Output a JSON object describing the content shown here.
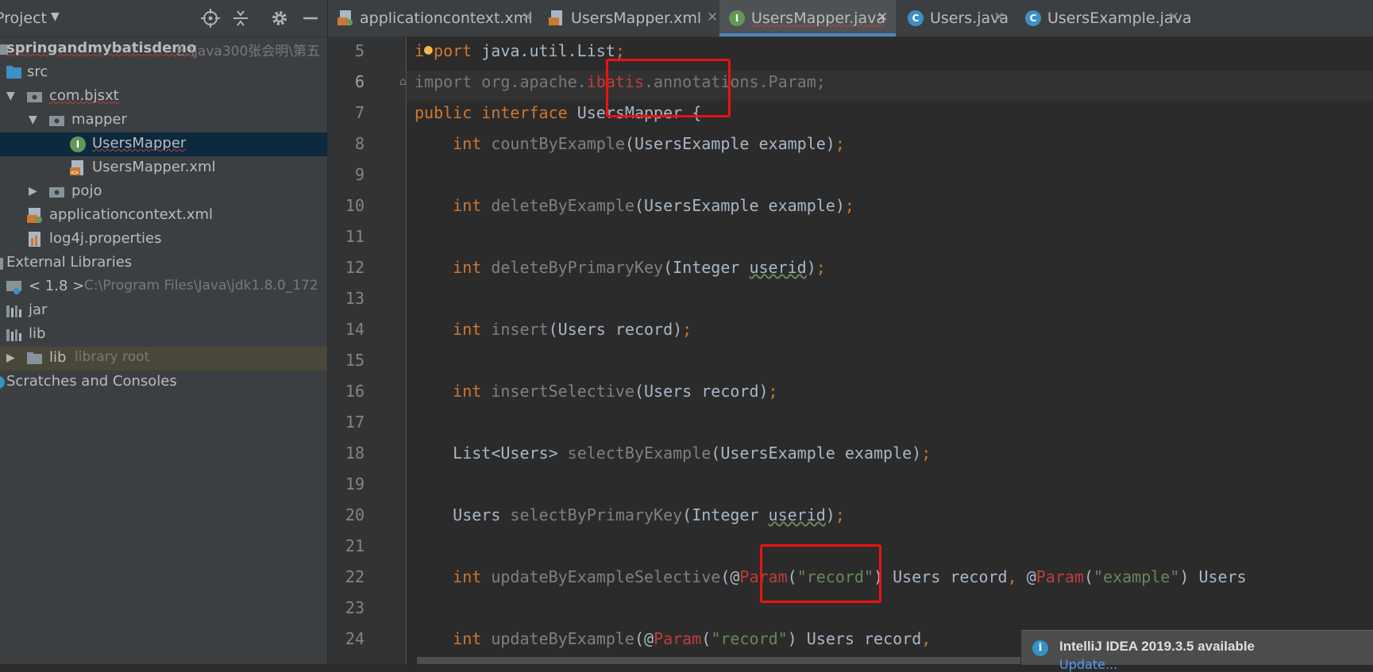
{
  "project_panel": {
    "title": "Project",
    "tree": [
      {
        "label": "springandmybatisdemo",
        "hint": "E:\\java300张会明\\第五"
      },
      {
        "label": "src"
      },
      {
        "label": "com.bjsxt"
      },
      {
        "label": "mapper"
      },
      {
        "label": "UsersMapper"
      },
      {
        "label": "UsersMapper.xml"
      },
      {
        "label": "pojo"
      },
      {
        "label": "applicationcontext.xml"
      },
      {
        "label": "log4j.properties"
      },
      {
        "label": "External Libraries"
      },
      {
        "label": "< 1.8 >",
        "hint": "C:\\Program Files\\Java\\jdk1.8.0_172"
      },
      {
        "label": "jar"
      },
      {
        "label": "lib"
      },
      {
        "label": "lib",
        "hint": "library root"
      },
      {
        "label": "Scratches and Consoles"
      }
    ]
  },
  "tabs": [
    {
      "label": "applicationcontext.xml",
      "icon": "xml-file-icon"
    },
    {
      "label": "UsersMapper.xml",
      "icon": "xml-file-icon"
    },
    {
      "label": "UsersMapper.java",
      "icon": "interface-icon",
      "active": true
    },
    {
      "label": "Users.java",
      "icon": "class-icon"
    },
    {
      "label": "UsersExample.java",
      "icon": "class-icon"
    }
  ],
  "editor": {
    "line_numbers": [
      "5",
      "6",
      "7",
      "8",
      "9",
      "10",
      "11",
      "12",
      "13",
      "14",
      "15",
      "16",
      "17",
      "18",
      "19",
      "20",
      "21",
      "22",
      "23",
      "24"
    ],
    "current_line": "6",
    "code": {
      "l5_a": "i",
      "l5_b": "port ",
      "l5_c": "java.util.List",
      "l5_d": ";",
      "l6_a": "import ",
      "l6_b": "org.apache.",
      "l6_c": "ibatis",
      "l6_d": ".annotations.Param;",
      "l7_a": "public interface ",
      "l7_b": "UsersMapper {",
      "l8_kw": "int ",
      "l8_m": "countByExample",
      "l8_rest": "(UsersExample example)",
      "l8_p": ";",
      "l10_kw": "int ",
      "l10_m": "deleteByExample",
      "l10_rest": "(UsersExample example)",
      "l10_p": ";",
      "l12_kw": "int ",
      "l12_m": "deleteByPrimaryKey",
      "l12_a": "(Integer ",
      "l12_b": "userid",
      "l12_c": ")",
      "l12_p": ";",
      "l14_kw": "int ",
      "l14_m": "insert",
      "l14_rest": "(Users record)",
      "l14_p": ";",
      "l16_kw": "int ",
      "l16_m": "insertSelective",
      "l16_rest": "(Users record)",
      "l16_p": ";",
      "l18_a": "List<Users> ",
      "l18_m": "selectByExample",
      "l18_rest": "(UsersExample example)",
      "l18_p": ";",
      "l20_a": "Users ",
      "l20_m": "selectByPrimaryKey",
      "l20_b": "(Integer ",
      "l20_c": "userid",
      "l20_d": ")",
      "l20_p": ";",
      "l22_kw": "int ",
      "l22_m": "updateByExampleSelective",
      "l22_a": "(@",
      "l22_b": "Param",
      "l22_c": "(",
      "l22_d": "\"record\"",
      "l22_e": ") Users record",
      "l22_f": ", ",
      "l22_g": "@",
      "l22_h": "Param",
      "l22_i": "(",
      "l22_j": "\"example\"",
      "l22_k": ") Users",
      "l24_kw": "int ",
      "l24_m": "updateByExample",
      "l24_a": "(@",
      "l24_b": "Param",
      "l24_c": "(",
      "l24_d": "\"record\"",
      "l24_e": ") Users record",
      "l24_f": ","
    }
  },
  "notification": {
    "title": "IntelliJ IDEA 2019.3.5 available",
    "link": "Update..."
  }
}
